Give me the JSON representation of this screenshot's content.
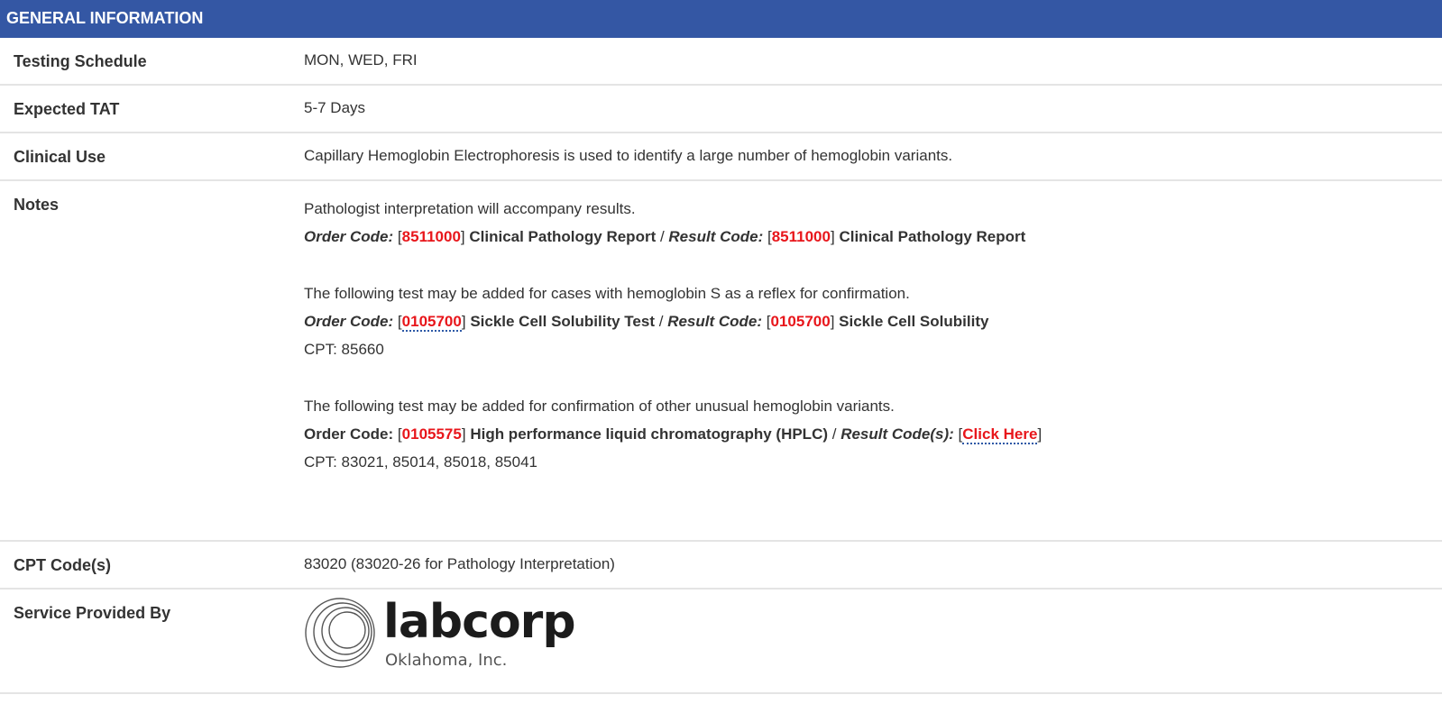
{
  "header": {
    "title": "GENERAL INFORMATION"
  },
  "rows": {
    "testing_schedule": {
      "label": "Testing Schedule",
      "value": "MON, WED, FRI"
    },
    "expected_tat": {
      "label": "Expected TAT",
      "value": "5-7 Days"
    },
    "clinical_use": {
      "label": "Clinical Use",
      "value": "Capillary Hemoglobin Electrophoresis is used to identify a large number of hemoglobin variants."
    },
    "notes": {
      "label": "Notes",
      "p1": {
        "text": "Pathologist interpretation will accompany results.",
        "order_label": "Order Code:",
        "order_code": "8511000",
        "order_name": "Clinical Pathology Report",
        "result_label": "Result Code:",
        "result_code": "8511000",
        "result_name": "Clinical Pathology Report"
      },
      "p2": {
        "text": "The following test may be added for cases with hemoglobin S as a reflex for confirmation.",
        "order_label": "Order Code:",
        "order_code": "0105700",
        "order_name": "Sickle Cell Solubility Test",
        "result_label": "Result Code:",
        "result_code": "0105700",
        "result_name": "Sickle Cell Solubility",
        "cpt": "CPT: 85660"
      },
      "p3": {
        "text": "The following test may be added for confirmation of other unusual hemoglobin variants.",
        "order_label": "Order Code:",
        "order_code": "0105575",
        "order_name": "High performance liquid chromatography (HPLC)",
        "result_label": "Result Code(s):",
        "result_link": "Click Here",
        "cpt": "CPT: 83021, 85014, 85018, 85041"
      }
    },
    "cpt_codes": {
      "label": "CPT Code(s)",
      "value": "83020 (83020-26 for Pathology Interpretation)"
    },
    "service": {
      "label": "Service Provided By",
      "logo_name": "labcorp",
      "logo_sub": "Oklahoma, Inc."
    }
  },
  "punct": {
    "open": "[",
    "close": "]",
    "slash": " / "
  },
  "colors": {
    "header_bg": "#3457a4",
    "code_red": "#e8161b",
    "divider": "#e4e4e4"
  }
}
